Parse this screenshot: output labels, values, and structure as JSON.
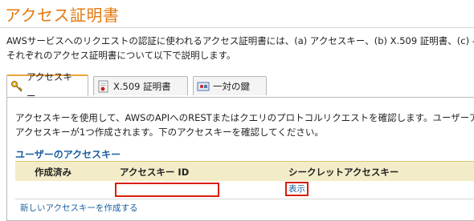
{
  "page": {
    "title": "アクセス証明書",
    "intro_line1": "AWSサービスへのリクエストの認証に使われるアクセス証明書には、(a) アクセスキー、(b) X.509 証明書、(c) -",
    "intro_line2": "それぞれのアクセス証明書について以下で説明します。"
  },
  "tabs": [
    {
      "label": "アクセスキー",
      "icon": "key-icon",
      "active": true
    },
    {
      "label": "X.509 証明書",
      "icon": "certificate-icon",
      "active": false
    },
    {
      "label": "一対の鍵",
      "icon": "keypair-icon",
      "active": false
    }
  ],
  "panel": {
    "text_line1": "アクセスキーを使用して、AWSのAPIへのRESTまたはクエリのプロトコルリクエストを確認します。ユーザーアカウ",
    "text_line2": "アクセスキーが1つ作成されます。下のアクセスキーを確認してください。",
    "section_heading": "ユーザーのアクセスキー",
    "table": {
      "columns": [
        "作成済み",
        "アクセスキー ID",
        "シークレットアクセスキー"
      ],
      "rows": [
        {
          "created": "",
          "access_key_id": "",
          "secret_link": "表示"
        }
      ]
    },
    "create_link": "新しいアクセスキーを作成する"
  },
  "colors": {
    "title": "#e47911",
    "link": "#1a5fa0",
    "table_header_bg": "#f3ecc9",
    "highlight_box": "#d81e05",
    "active_tab_border": "#e8a33c"
  }
}
